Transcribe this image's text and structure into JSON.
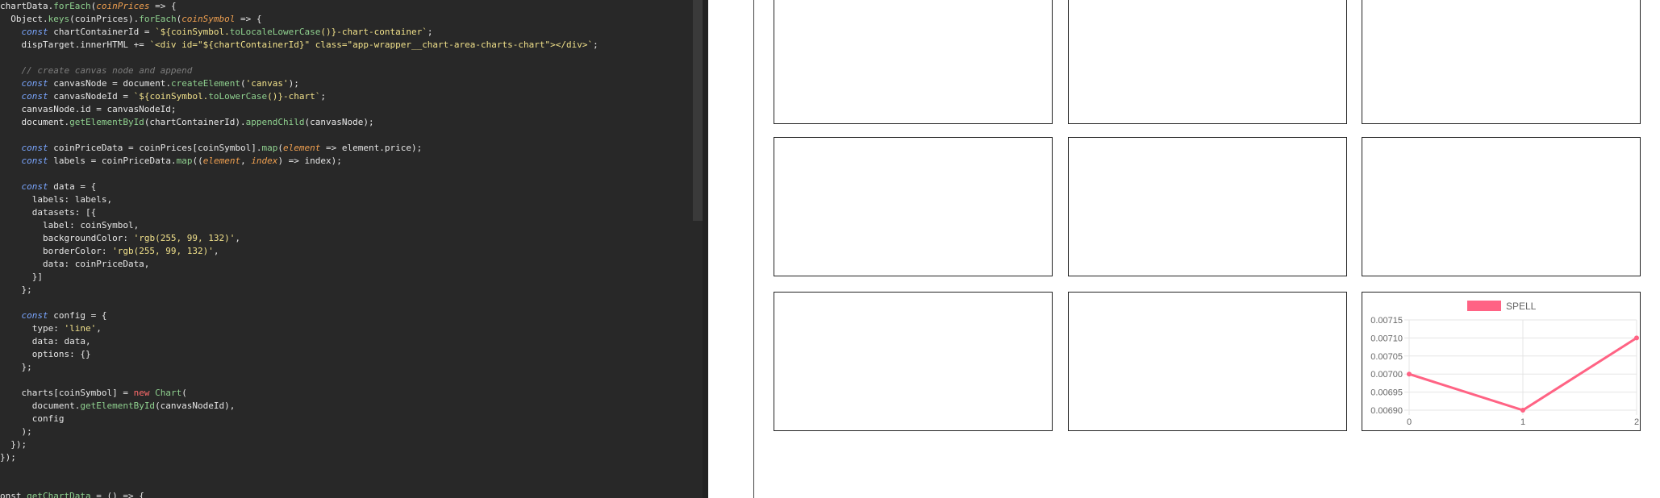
{
  "editor": {
    "lines": [
      [
        [
          "chartData.",
          ""
        ],
        [
          "forEach",
          "fn"
        ],
        [
          "(",
          ""
        ],
        [
          "coinPrices",
          "par"
        ],
        [
          " => {",
          ""
        ]
      ],
      [
        [
          "  Object.",
          ""
        ],
        [
          "keys",
          "fn"
        ],
        [
          "(coinPrices).",
          ""
        ],
        [
          "forEach",
          "fn"
        ],
        [
          "(",
          ""
        ],
        [
          "coinSymbol",
          "par"
        ],
        [
          " => {",
          ""
        ]
      ],
      [
        [
          "    ",
          ""
        ],
        [
          "const",
          "kw"
        ],
        [
          " chartContainerId = ",
          ""
        ],
        [
          "`${coinSymbol.",
          "str"
        ],
        [
          "toLocaleLowerCase",
          "fn"
        ],
        [
          "()}-chart-container`",
          "str"
        ],
        [
          ";",
          ""
        ]
      ],
      [
        [
          "    dispTarget.innerHTML += ",
          ""
        ],
        [
          "`<div id=\"${chartContainerId}\" class=\"app-wrapper__chart-area-charts-chart\"></div>`",
          "str"
        ],
        [
          ";",
          ""
        ]
      ],
      [
        [
          "",
          ""
        ]
      ],
      [
        [
          "    ",
          ""
        ],
        [
          "// create canvas node and append",
          "cm"
        ]
      ],
      [
        [
          "    ",
          ""
        ],
        [
          "const",
          "kw"
        ],
        [
          " canvasNode = document.",
          ""
        ],
        [
          "createElement",
          "fn"
        ],
        [
          "(",
          ""
        ],
        [
          "'canvas'",
          "str"
        ],
        [
          ");",
          ""
        ]
      ],
      [
        [
          "    ",
          ""
        ],
        [
          "const",
          "kw"
        ],
        [
          " canvasNodeId = ",
          ""
        ],
        [
          "`${coinSymbol.",
          "str"
        ],
        [
          "toLowerCase",
          "fn"
        ],
        [
          "()}-chart`",
          "str"
        ],
        [
          ";",
          ""
        ]
      ],
      [
        [
          "    canvasNode.id = canvasNodeId;",
          ""
        ]
      ],
      [
        [
          "    document.",
          ""
        ],
        [
          "getElementById",
          "fn"
        ],
        [
          "(chartContainerId).",
          ""
        ],
        [
          "appendChild",
          "fn"
        ],
        [
          "(canvasNode);",
          ""
        ]
      ],
      [
        [
          "",
          ""
        ]
      ],
      [
        [
          "    ",
          ""
        ],
        [
          "const",
          "kw"
        ],
        [
          " coinPriceData = coinPrices[coinSymbol].",
          ""
        ],
        [
          "map",
          "fn"
        ],
        [
          "(",
          ""
        ],
        [
          "element",
          "par"
        ],
        [
          " => element.price);",
          ""
        ]
      ],
      [
        [
          "    ",
          ""
        ],
        [
          "const",
          "kw"
        ],
        [
          " labels = coinPriceData.",
          ""
        ],
        [
          "map",
          "fn"
        ],
        [
          "((",
          ""
        ],
        [
          "element",
          "par"
        ],
        [
          ", ",
          ""
        ],
        [
          "index",
          "par"
        ],
        [
          ") => index);",
          ""
        ]
      ],
      [
        [
          "",
          ""
        ]
      ],
      [
        [
          "    ",
          ""
        ],
        [
          "const",
          "kw"
        ],
        [
          " data = {",
          ""
        ]
      ],
      [
        [
          "      labels: labels,",
          ""
        ]
      ],
      [
        [
          "      datasets: [{",
          ""
        ]
      ],
      [
        [
          "        label: coinSymbol,",
          ""
        ]
      ],
      [
        [
          "        backgroundColor: ",
          ""
        ],
        [
          "'rgb(255, 99, 132)'",
          "str"
        ],
        [
          ",",
          ""
        ]
      ],
      [
        [
          "        borderColor: ",
          ""
        ],
        [
          "'rgb(255, 99, 132)'",
          "str"
        ],
        [
          ",",
          ""
        ]
      ],
      [
        [
          "        data: coinPriceData,",
          ""
        ]
      ],
      [
        [
          "      }]",
          ""
        ]
      ],
      [
        [
          "    };",
          ""
        ]
      ],
      [
        [
          "",
          ""
        ]
      ],
      [
        [
          "    ",
          ""
        ],
        [
          "const",
          "kw"
        ],
        [
          " config = {",
          ""
        ]
      ],
      [
        [
          "      type: ",
          ""
        ],
        [
          "'line'",
          "str"
        ],
        [
          ",",
          ""
        ]
      ],
      [
        [
          "      data: data,",
          ""
        ]
      ],
      [
        [
          "      options: {}",
          ""
        ]
      ],
      [
        [
          "    };",
          ""
        ]
      ],
      [
        [
          "",
          ""
        ]
      ],
      [
        [
          "    charts[coinSymbol] = ",
          ""
        ],
        [
          "new",
          "nw"
        ],
        [
          " ",
          ""
        ],
        [
          "Chart",
          "fn"
        ],
        [
          "(",
          ""
        ]
      ],
      [
        [
          "      document.",
          ""
        ],
        [
          "getElementById",
          "fn"
        ],
        [
          "(canvasNodeId),",
          ""
        ]
      ],
      [
        [
          "      config",
          ""
        ]
      ],
      [
        [
          "    );",
          ""
        ]
      ],
      [
        [
          "  });",
          ""
        ]
      ],
      [
        [
          "});",
          ""
        ]
      ],
      [
        [
          "",
          ""
        ]
      ],
      [
        [
          "",
          ""
        ]
      ],
      [
        [
          "onst ",
          ""
        ],
        [
          "getChartData",
          "fn"
        ],
        [
          " = () => {",
          ""
        ]
      ]
    ]
  },
  "chart_data": {
    "type": "line",
    "legend": "SPELL",
    "legend_position": "top",
    "x": [
      0,
      1,
      2
    ],
    "y": [
      0.007,
      0.0069,
      0.0071
    ],
    "ylim": [
      0.0069,
      0.00715
    ],
    "y_ticks": [
      "0.00715",
      "0.00710",
      "0.00705",
      "0.00700",
      "0.00695",
      "0.00690"
    ],
    "x_ticks": [
      "0",
      "1",
      "2"
    ],
    "color": "#ff6384",
    "grid": true
  }
}
